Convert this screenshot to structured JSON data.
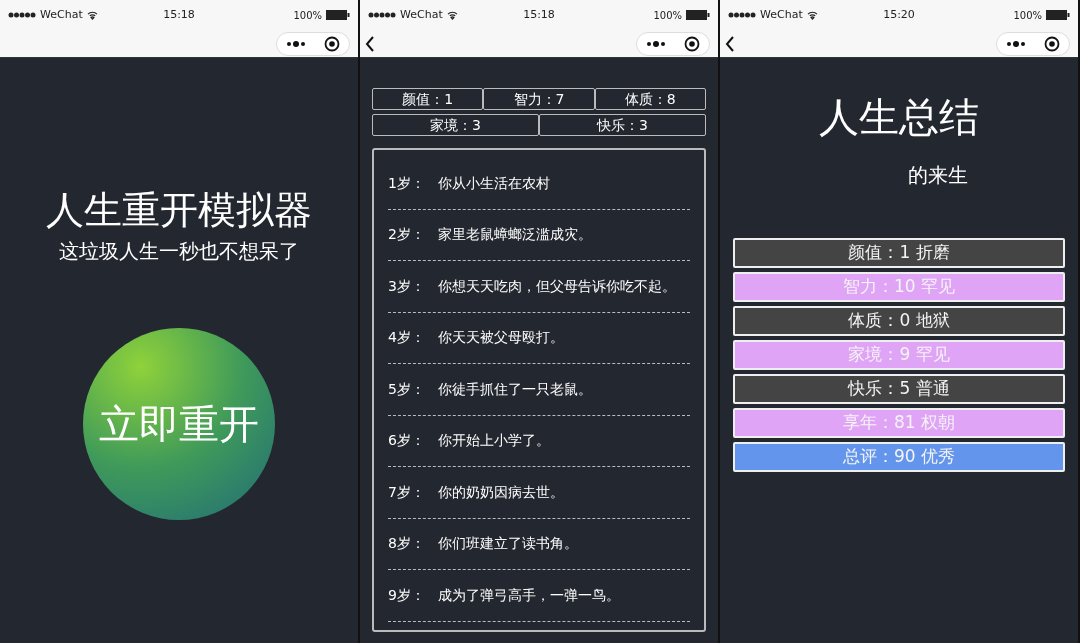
{
  "screens": [
    {
      "kind": "home",
      "status_bar": {
        "carrier": "WeChat",
        "time": "15:18",
        "battery": "100%"
      },
      "nav": {
        "back_button": false
      },
      "title": "人生重开模拟器",
      "subtitle": "这垃圾人生一秒也不想呆了",
      "start_button": "立即重开"
    },
    {
      "kind": "log",
      "status_bar": {
        "carrier": "WeChat",
        "time": "15:18",
        "battery": "100%"
      },
      "nav": {
        "back_button": true
      },
      "stats_row_1": [
        "颜值：1",
        "智力：7",
        "体质：8"
      ],
      "stats_row_2": [
        "家境：3",
        "快乐：3"
      ],
      "events": [
        {
          "age": "1岁：",
          "text": "你从小生活在农村"
        },
        {
          "age": "2岁：",
          "text": "家里老鼠蟑螂泛滥成灾。"
        },
        {
          "age": "3岁：",
          "text": "你想天天吃肉，但父母告诉你吃不起。"
        },
        {
          "age": "4岁：",
          "text": "你天天被父母殴打。"
        },
        {
          "age": "5岁：",
          "text": "你徒手抓住了一只老鼠。"
        },
        {
          "age": "6岁：",
          "text": "你开始上小学了。"
        },
        {
          "age": "7岁：",
          "text": "你的奶奶因病去世。"
        },
        {
          "age": "8岁：",
          "text": "你们班建立了读书角。"
        },
        {
          "age": "9岁：",
          "text": "成为了弹弓高手，一弹一鸟。"
        }
      ]
    },
    {
      "kind": "summary",
      "status_bar": {
        "carrier": "WeChat",
        "time": "15:20",
        "battery": "100%"
      },
      "nav": {
        "back_button": true
      },
      "title": "人生总结",
      "subtitle": "的来生",
      "results": [
        {
          "text": "颜值：1 折磨",
          "color": "#444444"
        },
        {
          "text": "智力：10 罕见",
          "color": "#e0a4f7"
        },
        {
          "text": "体质：0 地狱",
          "color": "#444444"
        },
        {
          "text": "家境：9 罕见",
          "color": "#e0a4f7"
        },
        {
          "text": "快乐：5 普通",
          "color": "#444444"
        },
        {
          "text": "享年：81 权朝",
          "color": "#e0a4f7"
        },
        {
          "text": "总评：90 优秀",
          "color": "#6495ed"
        }
      ]
    }
  ]
}
